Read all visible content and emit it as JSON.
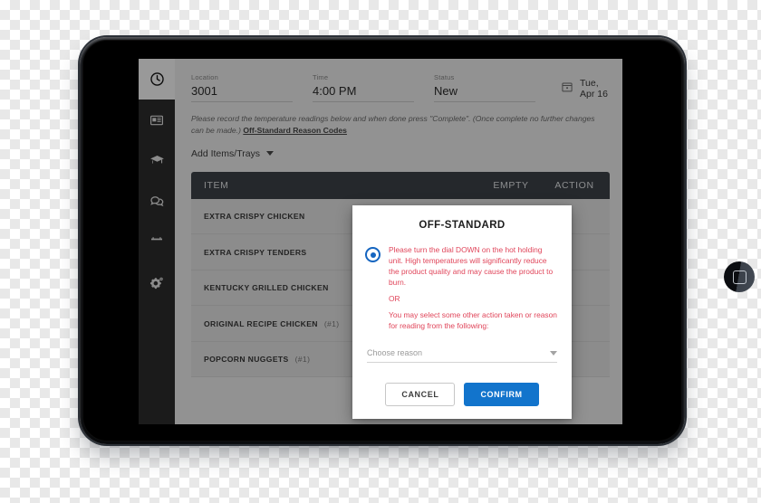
{
  "device": {
    "home_button_icon": "home-square-icon",
    "camera_icon": "front-camera-icon"
  },
  "sidebar": {
    "items": [
      {
        "icon": "clock-icon",
        "name": "sidebar-item-clock",
        "active": true
      },
      {
        "icon": "news-card-icon",
        "name": "sidebar-item-news",
        "active": false
      },
      {
        "icon": "graduation-cap-icon",
        "name": "sidebar-item-training",
        "active": false
      },
      {
        "icon": "chat-bubbles-icon",
        "name": "sidebar-item-messages",
        "active": false
      },
      {
        "icon": "calendar-icon",
        "name": "sidebar-item-calendar",
        "active": false
      },
      {
        "icon": "gears-icon",
        "name": "sidebar-item-settings",
        "active": false
      }
    ]
  },
  "header": {
    "location_label": "Location",
    "location_value": "3001",
    "time_label": "Time",
    "time_value": "4:00 PM",
    "status_label": "Status",
    "status_value": "New",
    "date_icon": "calendar-icon",
    "date_value": "Tue, Apr 16"
  },
  "instructions": {
    "text": "Please record the temperature readings below and when done press \"Complete\". (Once complete no further changes can be made.) ",
    "link_text": "Off-Standard Reason Codes"
  },
  "toolbar": {
    "add_items_label": "Add Items/Trays",
    "caret_icon": "chevron-down-icon"
  },
  "table": {
    "columns": [
      "ITEM",
      "",
      "EMPTY",
      "ACTION"
    ],
    "rows": [
      {
        "item": "EXTRA CRISPY CHICKEN",
        "qty": "",
        "temp": "",
        "empty_checked": false
      },
      {
        "item": "EXTRA CRISPY TENDERS",
        "qty": "",
        "temp": "",
        "empty_checked": false
      },
      {
        "item": "KENTUCKY GRILLED CHICKEN",
        "qty": "",
        "temp": "",
        "empty_checked": false
      },
      {
        "item": "ORIGINAL RECIPE CHICKEN",
        "qty": "(#1)",
        "temp": "",
        "empty_checked": false
      },
      {
        "item": "POPCORN NUGGETS",
        "qty": "(#1)",
        "temp": "",
        "empty_checked": false
      }
    ]
  },
  "dialog": {
    "title": "OFF-STANDARD",
    "radio_selected": true,
    "message_main": "Please turn the dial DOWN on the hot holding unit. High temperatures will significantly reduce the product quality and may cause the product to burn.",
    "message_or": "OR",
    "message_second": "You may select some other action taken or reason for reading from the following:",
    "select_placeholder": "Choose reason",
    "select_caret_icon": "chevron-down-icon",
    "cancel_label": "CANCEL",
    "confirm_label": "CONFIRM"
  },
  "colors": {
    "accent_blue": "#1274cc",
    "radio_blue": "#1565c0",
    "alert_red": "#e0455a",
    "table_header": "#3f434a",
    "sidebar": "#2e2e2e"
  }
}
